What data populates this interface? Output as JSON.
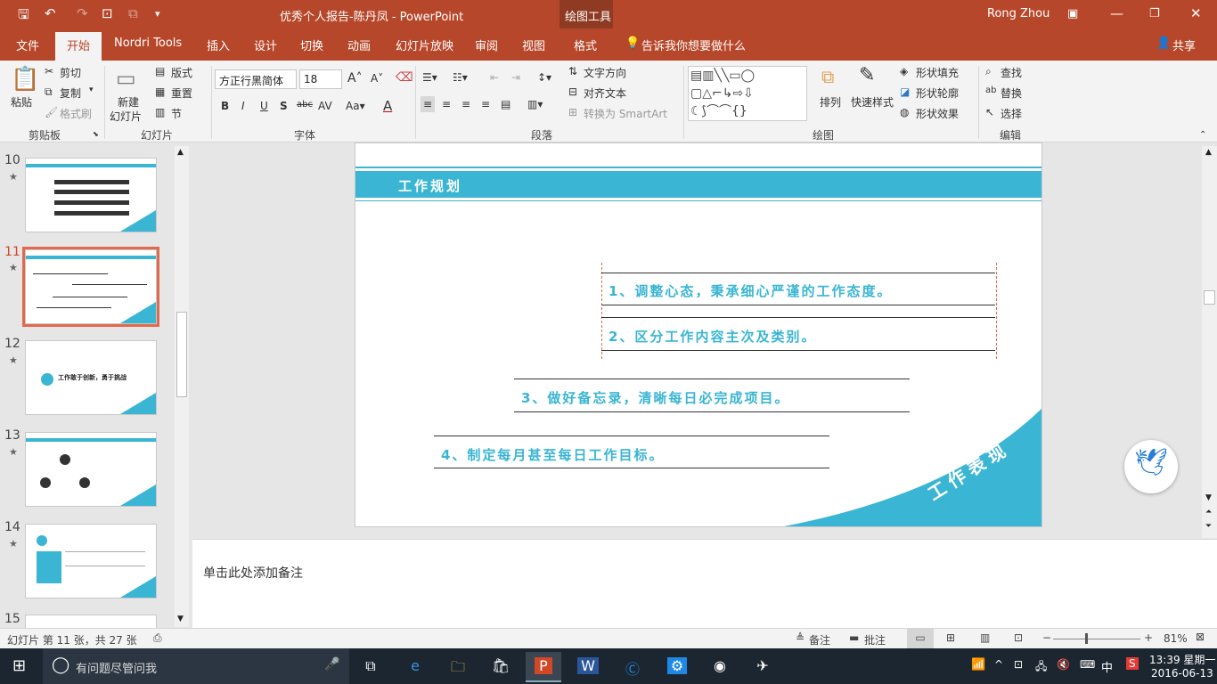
{
  "window": {
    "title": "优秀个人报告-陈丹凤 - PowerPoint",
    "context_tab": "绘图工具",
    "user": "Rong Zhou"
  },
  "tabs": [
    {
      "label": "文件"
    },
    {
      "label": "开始"
    },
    {
      "label": "Nordri Tools"
    },
    {
      "label": "插入"
    },
    {
      "label": "设计"
    },
    {
      "label": "切换"
    },
    {
      "label": "动画"
    },
    {
      "label": "幻灯片放映"
    },
    {
      "label": "审阅"
    },
    {
      "label": "视图"
    },
    {
      "label": "格式"
    }
  ],
  "tell_me": "告诉我你想要做什么",
  "share": "共享",
  "ribbon": {
    "paste": "粘贴",
    "cut": "剪切",
    "copy": "复制",
    "format_painter": "格式刷",
    "clipboard_group": "剪贴板",
    "new_slide_1": "新建",
    "new_slide_2": "幻灯片",
    "layout": "版式",
    "reset": "重置",
    "section": "节",
    "slides_group": "幻灯片",
    "font_name": "方正行黑简体",
    "font_size": "18",
    "font_group": "字体",
    "text_direction": "文字方向",
    "align_text": "对齐文本",
    "smartart": "转换为 SmartArt",
    "paragraph_group": "段落",
    "arrange": "排列",
    "quick_styles": "快速样式",
    "shape_fill": "形状填充",
    "shape_outline": "形状轮廓",
    "shape_effects": "形状效果",
    "drawing_group": "绘图",
    "find": "查找",
    "replace": "替换",
    "select": "选择",
    "editing_group": "编辑"
  },
  "thumbnails": [
    {
      "num": "10"
    },
    {
      "num": "11"
    },
    {
      "num": "12",
      "text": "工作敢于创新，勇于挑战"
    },
    {
      "num": "13"
    },
    {
      "num": "14"
    },
    {
      "num": "15"
    }
  ],
  "slide": {
    "header": "工作规划",
    "items": [
      "1、调整心态，秉承细心严谨的工作态度。",
      "2、区分工作内容主次及类别。",
      "3、做好备忘录，清晰每日必完成项目。",
      "4、制定每月甚至每日工作目标。"
    ],
    "corner": "工作表现"
  },
  "notes_placeholder": "单击此处添加备注",
  "status": {
    "slide_info": "幻灯片 第 11 张，共 27 张",
    "notes": "备注",
    "comments": "批注",
    "zoom": "81%"
  },
  "taskbar": {
    "search": "有问题尽管问我",
    "time": "13:39 星期一",
    "date": "2016-06-13",
    "ime": "中"
  },
  "colors": {
    "accent": "#b7472a",
    "slide_teal": "#3ab5d3"
  }
}
